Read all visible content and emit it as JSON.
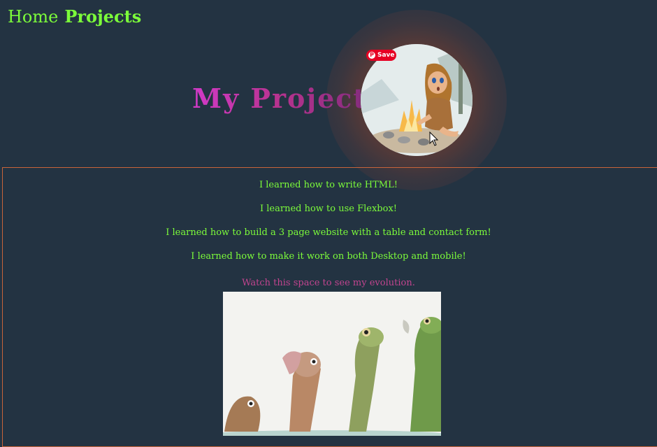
{
  "nav": {
    "items": [
      {
        "label": "Home",
        "active": false
      },
      {
        "label": "Projects",
        "active": true
      }
    ]
  },
  "hero": {
    "title": "My Projects",
    "avatar_alt": "cave-girl-lighting-fire-illustration",
    "save_label": "Save"
  },
  "content": {
    "learned": [
      "I learned how to write HTML!",
      "I learned how to use Flexbox!",
      "I learned how to build a 3 page website with a table and contact form!",
      "I learned how to make it work on both Desktop and mobile!"
    ],
    "evolution_note": "Watch this space to see my evolution.",
    "evolution_image_alt": "frog-evolution-illustration"
  },
  "colors": {
    "background": "#233342",
    "nav_text": "#7cfc3a",
    "learned_text": "#7cfc3a",
    "note_text": "#c2448f",
    "title_gradient_start": "#d13ac8",
    "title_gradient_end": "#7a2b7a",
    "border": "#c8643a",
    "pinterest": "#e60023"
  }
}
